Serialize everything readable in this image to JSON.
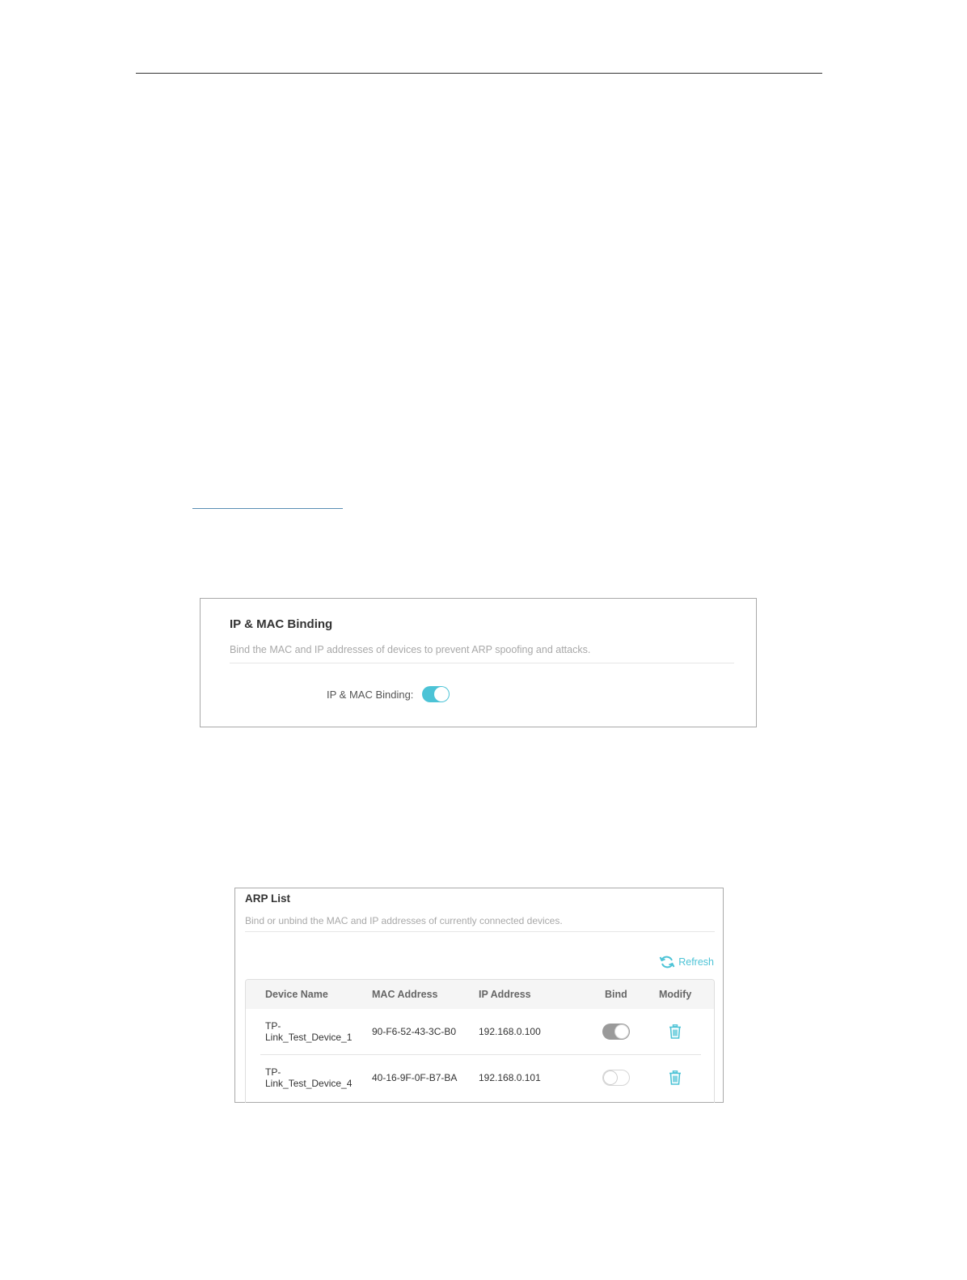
{
  "ip_mac_panel": {
    "title": "IP & MAC Binding",
    "description": "Bind the MAC and IP addresses of devices to prevent ARP spoofing and attacks.",
    "toggle_label": "IP & MAC Binding:",
    "toggle_state": "on"
  },
  "arp_panel": {
    "title": "ARP List",
    "description": "Bind or unbind the MAC and IP addresses of currently connected devices.",
    "refresh_label": "Refresh",
    "columns": [
      "Device Name",
      "MAC Address",
      "IP Address",
      "Bind",
      "Modify"
    ],
    "rows": [
      {
        "device_line1": "TP-",
        "device_line2": "Link_Test_Device_1",
        "mac": "90-F6-52-43-3C-B0",
        "ip": "192.168.0.100",
        "bind": "on"
      },
      {
        "device_line1": "TP-",
        "device_line2": "Link_Test_Device_4",
        "mac": "40-16-9F-0F-B7-BA",
        "ip": "192.168.0.101",
        "bind": "off"
      }
    ]
  },
  "colors": {
    "accent": "#4cc3d6",
    "toggle_gray": "#9a9a9a",
    "muted_text": "#a8a8a8"
  },
  "icons": [
    "refresh-icon",
    "trash-icon"
  ]
}
